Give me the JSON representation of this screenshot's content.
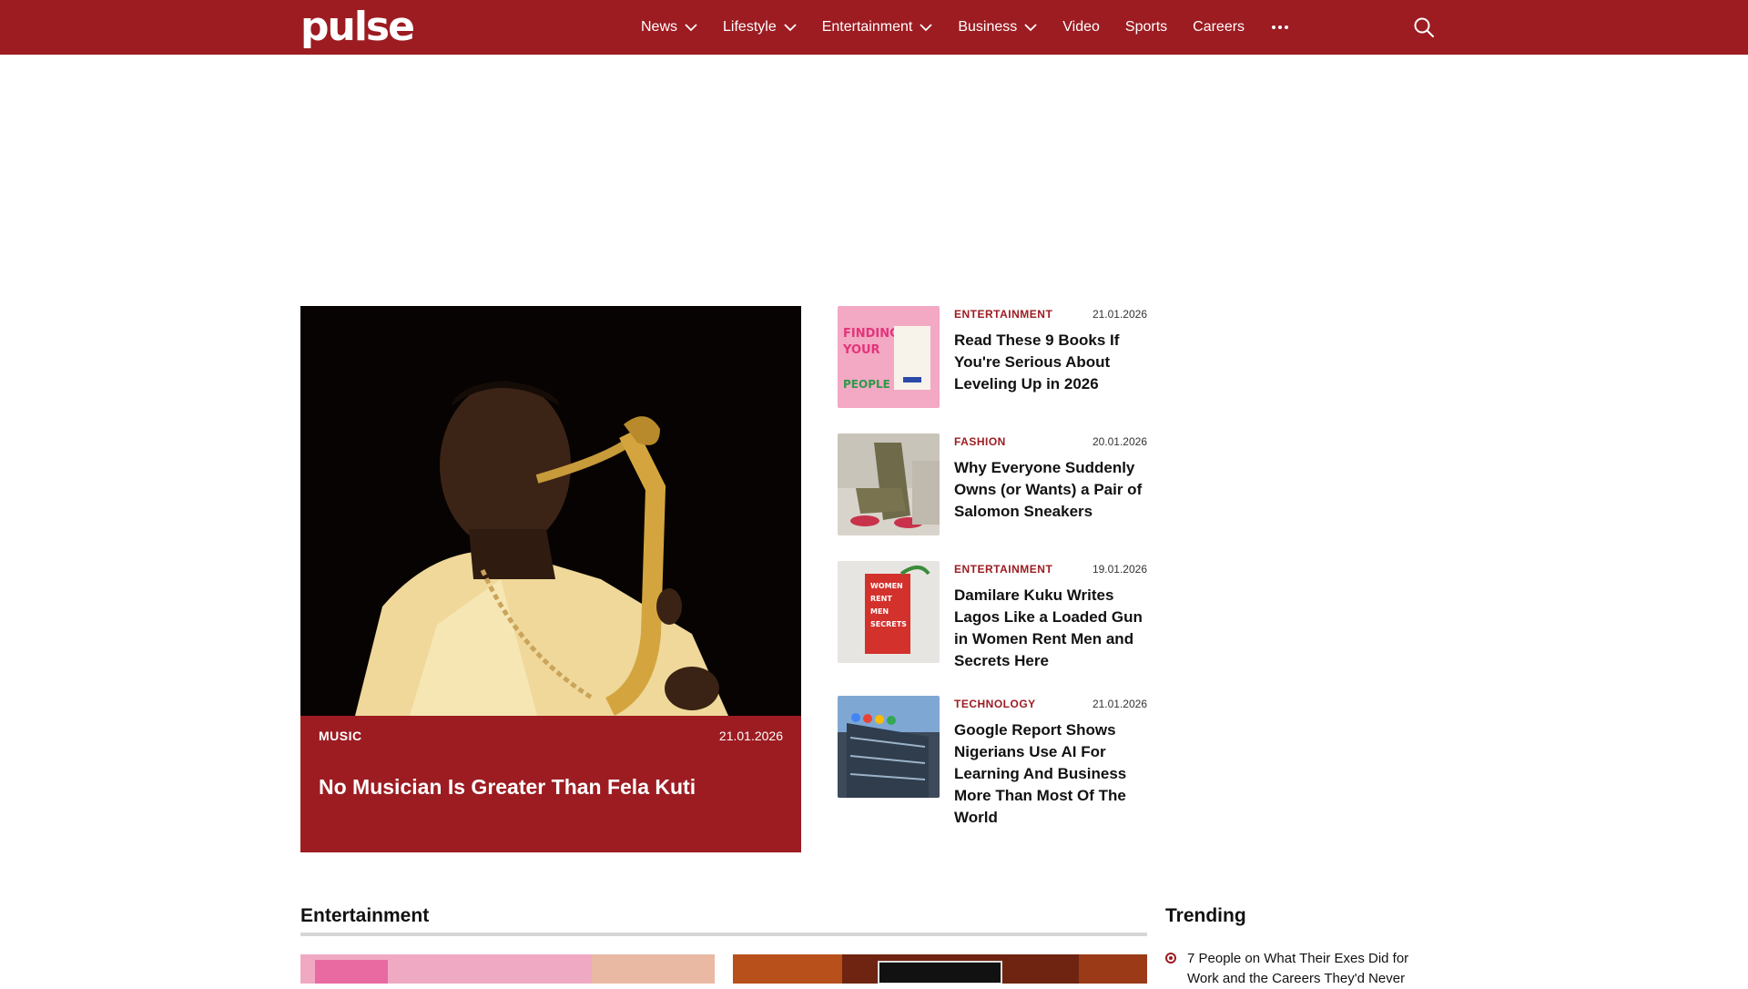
{
  "brand": {
    "logo_text": "pulse"
  },
  "nav": {
    "items": [
      {
        "label": "News",
        "has_dropdown": true
      },
      {
        "label": "Lifestyle",
        "has_dropdown": true
      },
      {
        "label": "Entertainment",
        "has_dropdown": true
      },
      {
        "label": "Business",
        "has_dropdown": true
      },
      {
        "label": "Video",
        "has_dropdown": false
      },
      {
        "label": "Sports",
        "has_dropdown": false
      },
      {
        "label": "Careers",
        "has_dropdown": false
      }
    ],
    "more_icon": "ellipsis-icon",
    "search_icon": "search-icon"
  },
  "hero": {
    "category": "MUSIC",
    "date": "21.01.2026",
    "title": "No Musician Is Greater Than Fela Kuti"
  },
  "side_articles": [
    {
      "category": "ENTERTAINMENT",
      "date": "21.01.2026",
      "title": "Read These 9 Books If You're Serious About Leveling Up in 2026"
    },
    {
      "category": "FASHION",
      "date": "20.01.2026",
      "title": "Why Everyone Suddenly Owns (or Wants) a Pair of Salomon Sneakers"
    },
    {
      "category": "ENTERTAINMENT",
      "date": "19.01.2026",
      "title": "Damilare Kuku Writes Lagos Like a Loaded Gun in Women Rent Men and Secrets Here"
    },
    {
      "category": "TECHNOLOGY",
      "date": "21.01.2026",
      "title": "Google Report Shows Nigerians Use AI For Learning And Business More Than Most Of The World"
    }
  ],
  "sections": {
    "entertainment_title": "Entertainment",
    "trending_title": "Trending",
    "trending_items": [
      "7 People on What Their Exes Did for Work and the Careers They'd Never"
    ]
  },
  "colors": {
    "brand": "#9c1c22",
    "white": "#ffffff"
  }
}
